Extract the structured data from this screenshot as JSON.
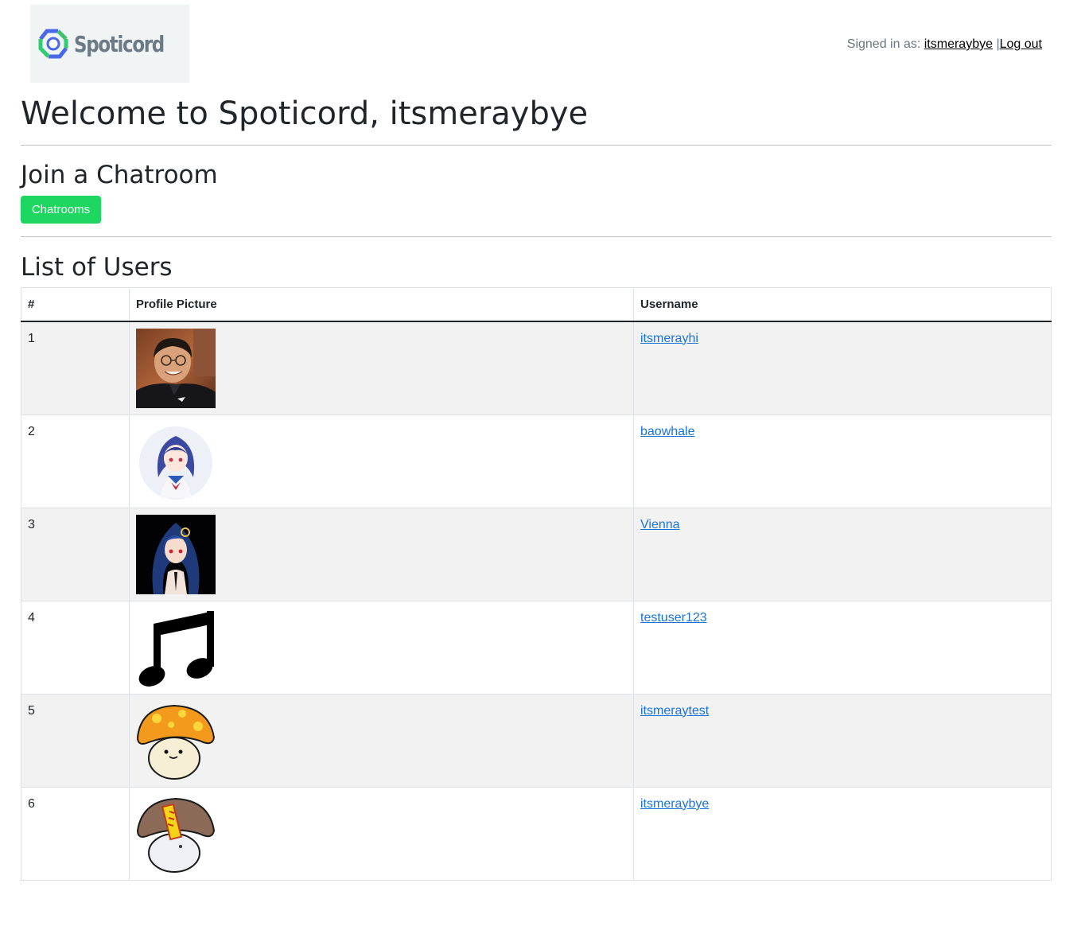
{
  "header": {
    "brand": "Spoticord",
    "signed_in_prefix": "Signed in as:",
    "username": "itsmeraybye",
    "separator": "|",
    "logout_label": "Log out"
  },
  "welcome_title": "Welcome to Spoticord, itsmeraybye",
  "join_section": {
    "heading": "Join a Chatroom",
    "button_label": "Chatrooms"
  },
  "users_section": {
    "heading": "List of Users",
    "columns": [
      "#",
      "Profile Picture",
      "Username"
    ],
    "rows": [
      {
        "num": "1",
        "username": "itsmerayhi",
        "avatar": "photo-avatar"
      },
      {
        "num": "2",
        "username": "baowhale",
        "avatar": "anime-girl-round-avatar"
      },
      {
        "num": "3",
        "username": "Vienna",
        "avatar": "anime-girl-dark-avatar"
      },
      {
        "num": "4",
        "username": "testuser123",
        "avatar": "music-note-avatar"
      },
      {
        "num": "5",
        "username": "itsmeraytest",
        "avatar": "orange-mushroom-avatar"
      },
      {
        "num": "6",
        "username": "itsmeraybye",
        "avatar": "brown-mushroom-avatar"
      }
    ]
  },
  "colors": {
    "accent_green": "#1ed760",
    "link_blue": "#1a73d9",
    "stripe": "#f2f2f2"
  }
}
